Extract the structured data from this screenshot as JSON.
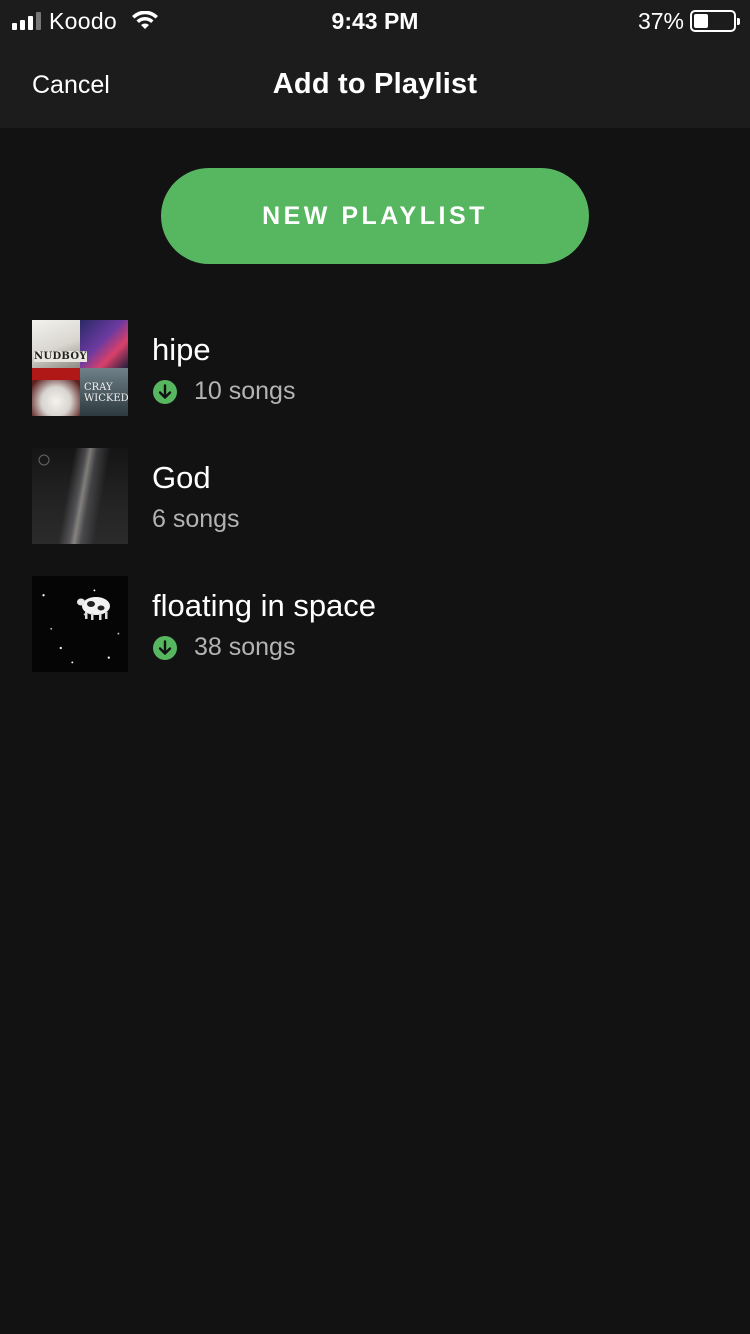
{
  "status_bar": {
    "carrier": "Koodo",
    "time": "9:43 PM",
    "battery_percent": "37%",
    "battery_level": 0.37,
    "signal_bars": 3,
    "signal_bars_total": 4
  },
  "nav": {
    "cancel_label": "Cancel",
    "title": "Add to Playlist"
  },
  "new_playlist_label": "NEW PLAYLIST",
  "colors": {
    "accent": "#57b660",
    "background": "#121212",
    "secondary_text": "#b3b3b3"
  },
  "playlists": [
    {
      "name": "hipe",
      "count": "10 songs",
      "downloaded": true,
      "cover": "mosaic",
      "mosaic_texts": [
        "NUDBOY",
        "CRAY WICKED"
      ]
    },
    {
      "name": "God",
      "count": "6 songs",
      "downloaded": false,
      "cover": "light-beam"
    },
    {
      "name": "floating in space",
      "count": "38 songs",
      "downloaded": true,
      "cover": "cow-in-space"
    }
  ]
}
